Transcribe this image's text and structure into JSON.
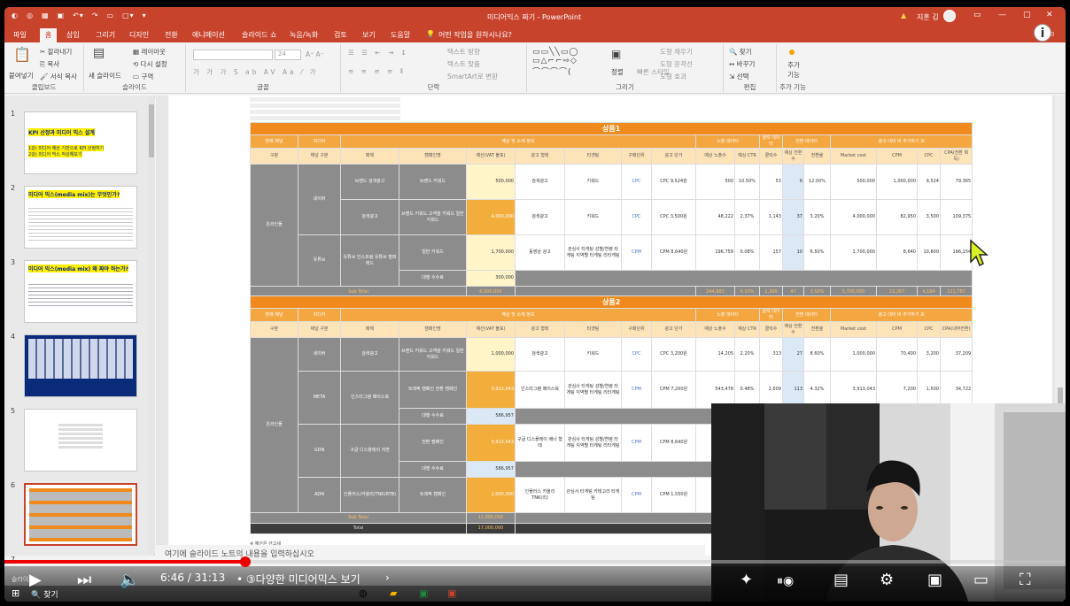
{
  "app": {
    "doc_title": "미디어믹스 짜기  -  PowerPoint",
    "user_name": "지훈 김",
    "warning": "▲"
  },
  "tabs": [
    "파일",
    "홈",
    "삽입",
    "그리기",
    "디자인",
    "전환",
    "애니메이션",
    "슬라이드 쇼",
    "녹음/녹화",
    "검토",
    "보기",
    "도움말"
  ],
  "tell_me": "어떤 작업을 원하시나요?",
  "ribbon": {
    "paste": "붙여넣기",
    "cut": "잘라내기",
    "copy": "복사",
    "format_copy": "서식 복사",
    "clipboard": "클립보드",
    "new_slide": "새 슬라이드",
    "layout": "레이아웃",
    "reset": "다시 설정",
    "section": "구역",
    "slides": "슬라이드",
    "font_size": "24",
    "font": "글꼴",
    "text_dir": "텍스트 방향",
    "text_align": "텍스트 맞춤",
    "smartart": "SmartArt로 변환",
    "paragraph": "단락",
    "arrange": "정렬",
    "quick_style": "빠른 스타일",
    "shape_fill": "도형 채우기",
    "shape_outline": "도형 윤곽선",
    "shape_effect": "도형 효과",
    "drawing": "그리기",
    "find": "찾기",
    "replace": "바꾸기",
    "select": "선택",
    "editing": "편집",
    "addins_btn": "추가 기능",
    "addins": "추가 기능"
  },
  "thumbs": [
    {
      "num": "1",
      "title": "KPI 산정과 미디어 믹스 설계",
      "lines": [
        "1강) 미디어 예산 기반으로 KPI 산정하기",
        "2강) 미디어 믹스 작성해보기"
      ]
    },
    {
      "num": "2",
      "title": "미디어 믹스(media mix)는 무엇인가?",
      "lines": []
    },
    {
      "num": "3",
      "title": "미디어 믹스(media mix) 왜 짜야 하는가?",
      "lines": []
    },
    {
      "num": "4",
      "title": "",
      "lines": []
    },
    {
      "num": "5",
      "title": "",
      "lines": []
    },
    {
      "num": "6",
      "title": "",
      "lines": []
    },
    {
      "num": "7",
      "title": "",
      "lines": []
    }
  ],
  "notes_placeholder": "여기에 슬라이드 노트의 내용을 입력하십시오",
  "slide_footnote": "※ 예산은 산고세",
  "product1": {
    "title": "상품1",
    "headers_top": [
      "판매 채널",
      "미디어",
      "예상 및 소재 정보",
      "",
      "",
      "노출 데이터",
      "클릭 데이터",
      "전환 데이터",
      "광고 대비 비 추가하기 보"
    ],
    "headers": [
      "구분",
      "채널 구분",
      "매체",
      "캠페인명",
      "예산(VAT 불포)",
      "광고 형태",
      "타겟팅",
      "구매단위",
      "광고 단가",
      "예상 노출수",
      "예상 CTR",
      "클릭수",
      "예상 전환수",
      "전환율",
      "Market cost",
      "CPM",
      "CPC",
      "CPA(전환 획득)"
    ],
    "rows": [
      {
        "c1": "온라인몰",
        "c2": "네이버",
        "c3": "브랜드 검색광고",
        "c4": "브랜드 키워드",
        "c5": "500,000",
        "c6": "검색광고",
        "c7": "키워드",
        "c8": "CPC",
        "c9": "CPC 9,524원",
        "c10": "500",
        "c11": "10.50%",
        "c12": "53",
        "c13": "6",
        "c14": "12.00%",
        "c15": "500,000",
        "c16": "1,000,000",
        "c17": "9,524",
        "c18": "79,365"
      },
      {
        "c1": "",
        "c2": "",
        "c3": "검색광고",
        "c4": "브랜드 키워드 고객을 키워드 일반 키워드",
        "c5": "4,000,000",
        "c6": "검색광고",
        "c7": "키워드",
        "c8": "CPC",
        "c9": "CPC 3,500원",
        "c10": "48,222",
        "c11": "2.37%",
        "c12": "1,143",
        "c13": "37",
        "c14": "3.20%",
        "c15": "4,000,000",
        "c16": "82,950",
        "c17": "3,500",
        "c18": "109,375"
      },
      {
        "c1": "",
        "c2": "유튜브",
        "c3": "유튜브 인스트림 유튜브 범퍼애드",
        "c4": "일반 키워드",
        "c5": "1,700,000",
        "c6": "동영상 광고",
        "c7": "관심사 타게팅 성별/연령 타게팅 지역별 타게팅 리타게팅",
        "c8": "CPM",
        "c9": "CPM 8,640원",
        "c10": "196,759",
        "c11": "0.08%",
        "c12": "157",
        "c13": "10",
        "c14": "6.50%",
        "c15": "1,700,000",
        "c16": "8,640",
        "c17": "10,800",
        "c18": "166,154"
      },
      {
        "c1": "",
        "c2": "",
        "c3": "",
        "c4": "대행 수수료",
        "c5": "300,000"
      }
    ],
    "subtotal": {
      "label": "Sub Total",
      "budget": "6,000,000",
      "v1": "244,981",
      "v2": "0.53%",
      "v3": "1,360",
      "v4": "47",
      "v5": "3.50%",
      "v6": "5,700,000",
      "v7": "23,267",
      "v8": "4,184",
      "v9": "121,787"
    }
  },
  "product2": {
    "title": "상품2",
    "headers_top": [
      "판매 채널",
      "미디어",
      "예상 및 소재 정보",
      "",
      "",
      "노출 데이터",
      "클릭 데이터",
      "전환 데이터",
      "광고 대비 비 추가하기 보"
    ],
    "headers": [
      "구분",
      "채널 구분",
      "매체",
      "캠페인명",
      "예산(VAT 불포)",
      "광고 형태",
      "타겟팅",
      "구매단위",
      "광고 단가",
      "예상 노출수",
      "예상 CTR",
      "클릭수",
      "예상 전환수",
      "전환율",
      "Market cost",
      "CPM",
      "CPC",
      "CPA(내부전환)"
    ],
    "rows": [
      {
        "c1": "온라인몰",
        "c2": "네이버",
        "c3": "검색광고",
        "c4": "브랜드 키워드 고객을 키워드 일반 키워드",
        "c5": "1,000,000",
        "c6": "검색광고",
        "c7": "키워드",
        "c8": "CPC",
        "c9": "CPC 3,200원",
        "c10": "14,205",
        "c11": "2.20%",
        "c12": "313",
        "c13": "27",
        "c14": "8.60%",
        "c15": "1,000,000",
        "c16": "70,400",
        "c17": "3,200",
        "c18": "37,209"
      },
      {
        "c1": "",
        "c2": "META",
        "c3": "인스타그램 페이스북",
        "c4": "트래픽 캠페인 전환 캠페인",
        "c5": "3,913,043",
        "c6": "인스타그램 페이스북",
        "c7": "관심사 타게팅 성별/연령 타게팅 지역별 타게팅 리타게팅",
        "c8": "CPM",
        "c9": "CPM 7,200원",
        "c10": "543,478",
        "c11": "0.48%",
        "c12": "2,609",
        "c13": "113",
        "c14": "4.32%",
        "c15": "3,913,043",
        "c16": "7,200",
        "c17": "1,500",
        "c18": "34,722"
      },
      {
        "c1": "",
        "c2": "",
        "c3": "",
        "c4": "대행 수수료",
        "c5": "586,957"
      },
      {
        "c1": "",
        "c2": "GDN",
        "c3": "구글 디스플레이 지면",
        "c4": "전환 캠페인",
        "c5": "3,913,043",
        "c6": "구글 디스플레이 배너 형태",
        "c7": "관심사 타게팅 성별/연령 타게팅 지역별 타게팅 리타게팅",
        "c8": "CPM",
        "c9": "CPM 8,640원"
      },
      {
        "c1": "",
        "c2": "",
        "c3": "",
        "c4": "대행 수수료",
        "c5": "586,957"
      },
      {
        "c1": "",
        "c2": "ADN",
        "c3": "인플러스/카울리/TNK(RTB)",
        "c4": "트래픽 캠페인",
        "c5": "1,000,000",
        "c6": "인플러스 카울리 TNK(리)",
        "c7": "관심사 타게팅 카테고리 타게팅",
        "c8": "CPM",
        "c9": "CPM 1,550원"
      }
    ],
    "subtotal": {
      "label": "Sub Total",
      "budget": "11,000,000"
    },
    "total": {
      "label": "Total",
      "budget": "17,000,000"
    }
  },
  "player": {
    "time": "6:46 / 31:13",
    "chapter": "• ③다양한 미디어믹스 보기",
    "search": "찾기",
    "slide_label": "슬라이드"
  },
  "colors": {
    "accent": "#c8432c",
    "orange": "#f08a1c",
    "progress": "#e00000"
  }
}
